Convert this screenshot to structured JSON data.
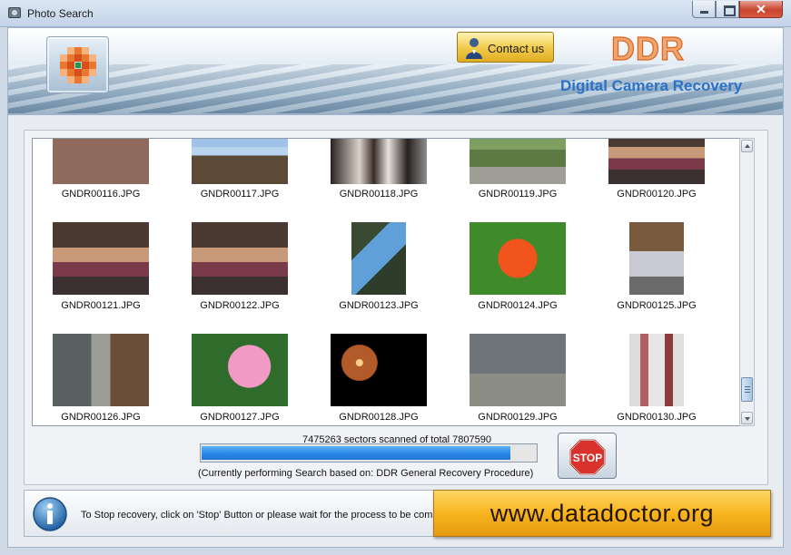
{
  "window": {
    "title": "Photo Search"
  },
  "header": {
    "contact_label": "Contact us",
    "brand": "DDR",
    "product": "Digital Camera Recovery"
  },
  "thumbnails": [
    {
      "name": "GNDR00116.JPG",
      "type": "brick"
    },
    {
      "name": "GNDR00117.JPG",
      "type": "nest"
    },
    {
      "name": "GNDR00118.JPG",
      "type": "party"
    },
    {
      "name": "GNDR00119.JPG",
      "type": "park"
    },
    {
      "name": "GNDR00120.JPG",
      "type": "group"
    },
    {
      "name": "GNDR00121.JPG",
      "type": "group"
    },
    {
      "name": "GNDR00122.JPG",
      "type": "group"
    },
    {
      "name": "GNDR00123.JPG",
      "type": "bird"
    },
    {
      "name": "GNDR00124.JPG",
      "type": "flower-red"
    },
    {
      "name": "GNDR00125.JPG",
      "type": "child"
    },
    {
      "name": "GNDR00126.JPG",
      "type": "statue"
    },
    {
      "name": "GNDR00127.JPG",
      "type": "rose"
    },
    {
      "name": "GNDR00128.JPG",
      "type": "fireworks"
    },
    {
      "name": "GNDR00129.JPG",
      "type": "goose"
    },
    {
      "name": "GNDR00130.JPG",
      "type": "market"
    }
  ],
  "scan": {
    "sectors_text": "7475263 sectors scanned of total 7807590",
    "progress_fraction": 0.957,
    "status_text": "(Currently performing Search based on:  DDR General Recovery Procedure)",
    "stop_label": "STOP"
  },
  "footer": {
    "message": "To Stop recovery, click on 'Stop' Button or please wait for the process to be comple",
    "url": "www.datadoctor.org"
  }
}
